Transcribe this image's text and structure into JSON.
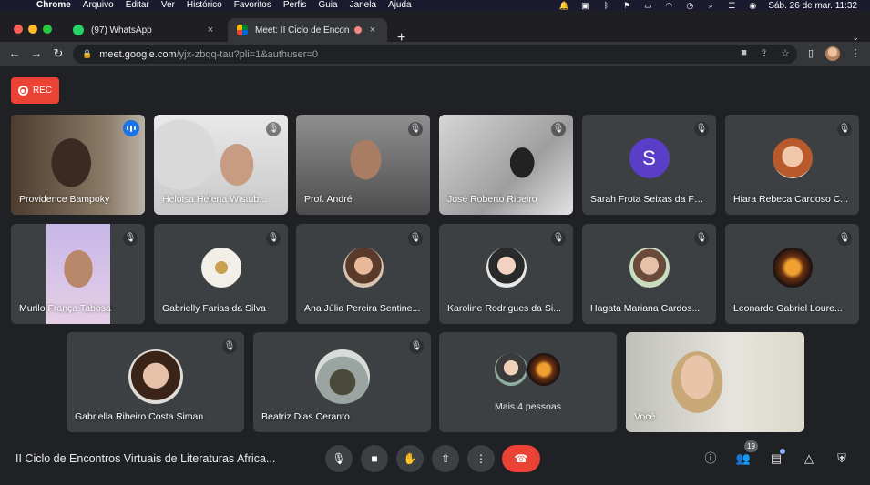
{
  "menubar": {
    "app": "Chrome",
    "items": [
      "Arquivo",
      "Editar",
      "Ver",
      "Histórico",
      "Favoritos",
      "Perfis",
      "Guia",
      "Janela",
      "Ajuda"
    ],
    "clock": "Sáb. 26 de mar.  11:32"
  },
  "tabs": [
    {
      "title": "(97) WhatsApp",
      "close": "×"
    },
    {
      "title": "Meet: II Ciclo de Encontros",
      "close": "×"
    }
  ],
  "toolbar": {
    "url_host": "meet.google.com",
    "url_path": "/yjx-zbqq-tau?pli=1&authuser=0"
  },
  "rec_label": "REC",
  "participants": [
    {
      "name": "Providence Bampoky",
      "speaking": true
    },
    {
      "name": "Heloisa Helena Wistub..."
    },
    {
      "name": "Prof. André"
    },
    {
      "name": "José Roberto Ribeiro"
    },
    {
      "name": "Sarah Frota Seixas da Fo...",
      "avatar_letter": "S"
    },
    {
      "name": "Hiara Rebeca Cardoso C..."
    },
    {
      "name": "Murilo França Tabosa"
    },
    {
      "name": "Gabrielly Farias da Silva"
    },
    {
      "name": "Ana Júlia Pereira Sentine..."
    },
    {
      "name": "Karoline Rodrigues da Si..."
    },
    {
      "name": "Hagata Mariana Cardos..."
    },
    {
      "name": "Leonardo Gabriel Loure..."
    },
    {
      "name": "Gabriella Ribeiro Costa Siman"
    },
    {
      "name": "Beatriz Dias Ceranto"
    }
  ],
  "more_people_label": "Mais 4 pessoas",
  "self_label": "Você",
  "meeting_title": "II Ciclo de Encontros Virtuais de Literaturas Africa...",
  "people_count": "19",
  "colors": {
    "background": "#202124",
    "tile": "#3c4043",
    "hangup": "#ea4335",
    "speaking_outline": "#8ab4f8",
    "avatar_letter_bg": "#5b3ec8"
  }
}
